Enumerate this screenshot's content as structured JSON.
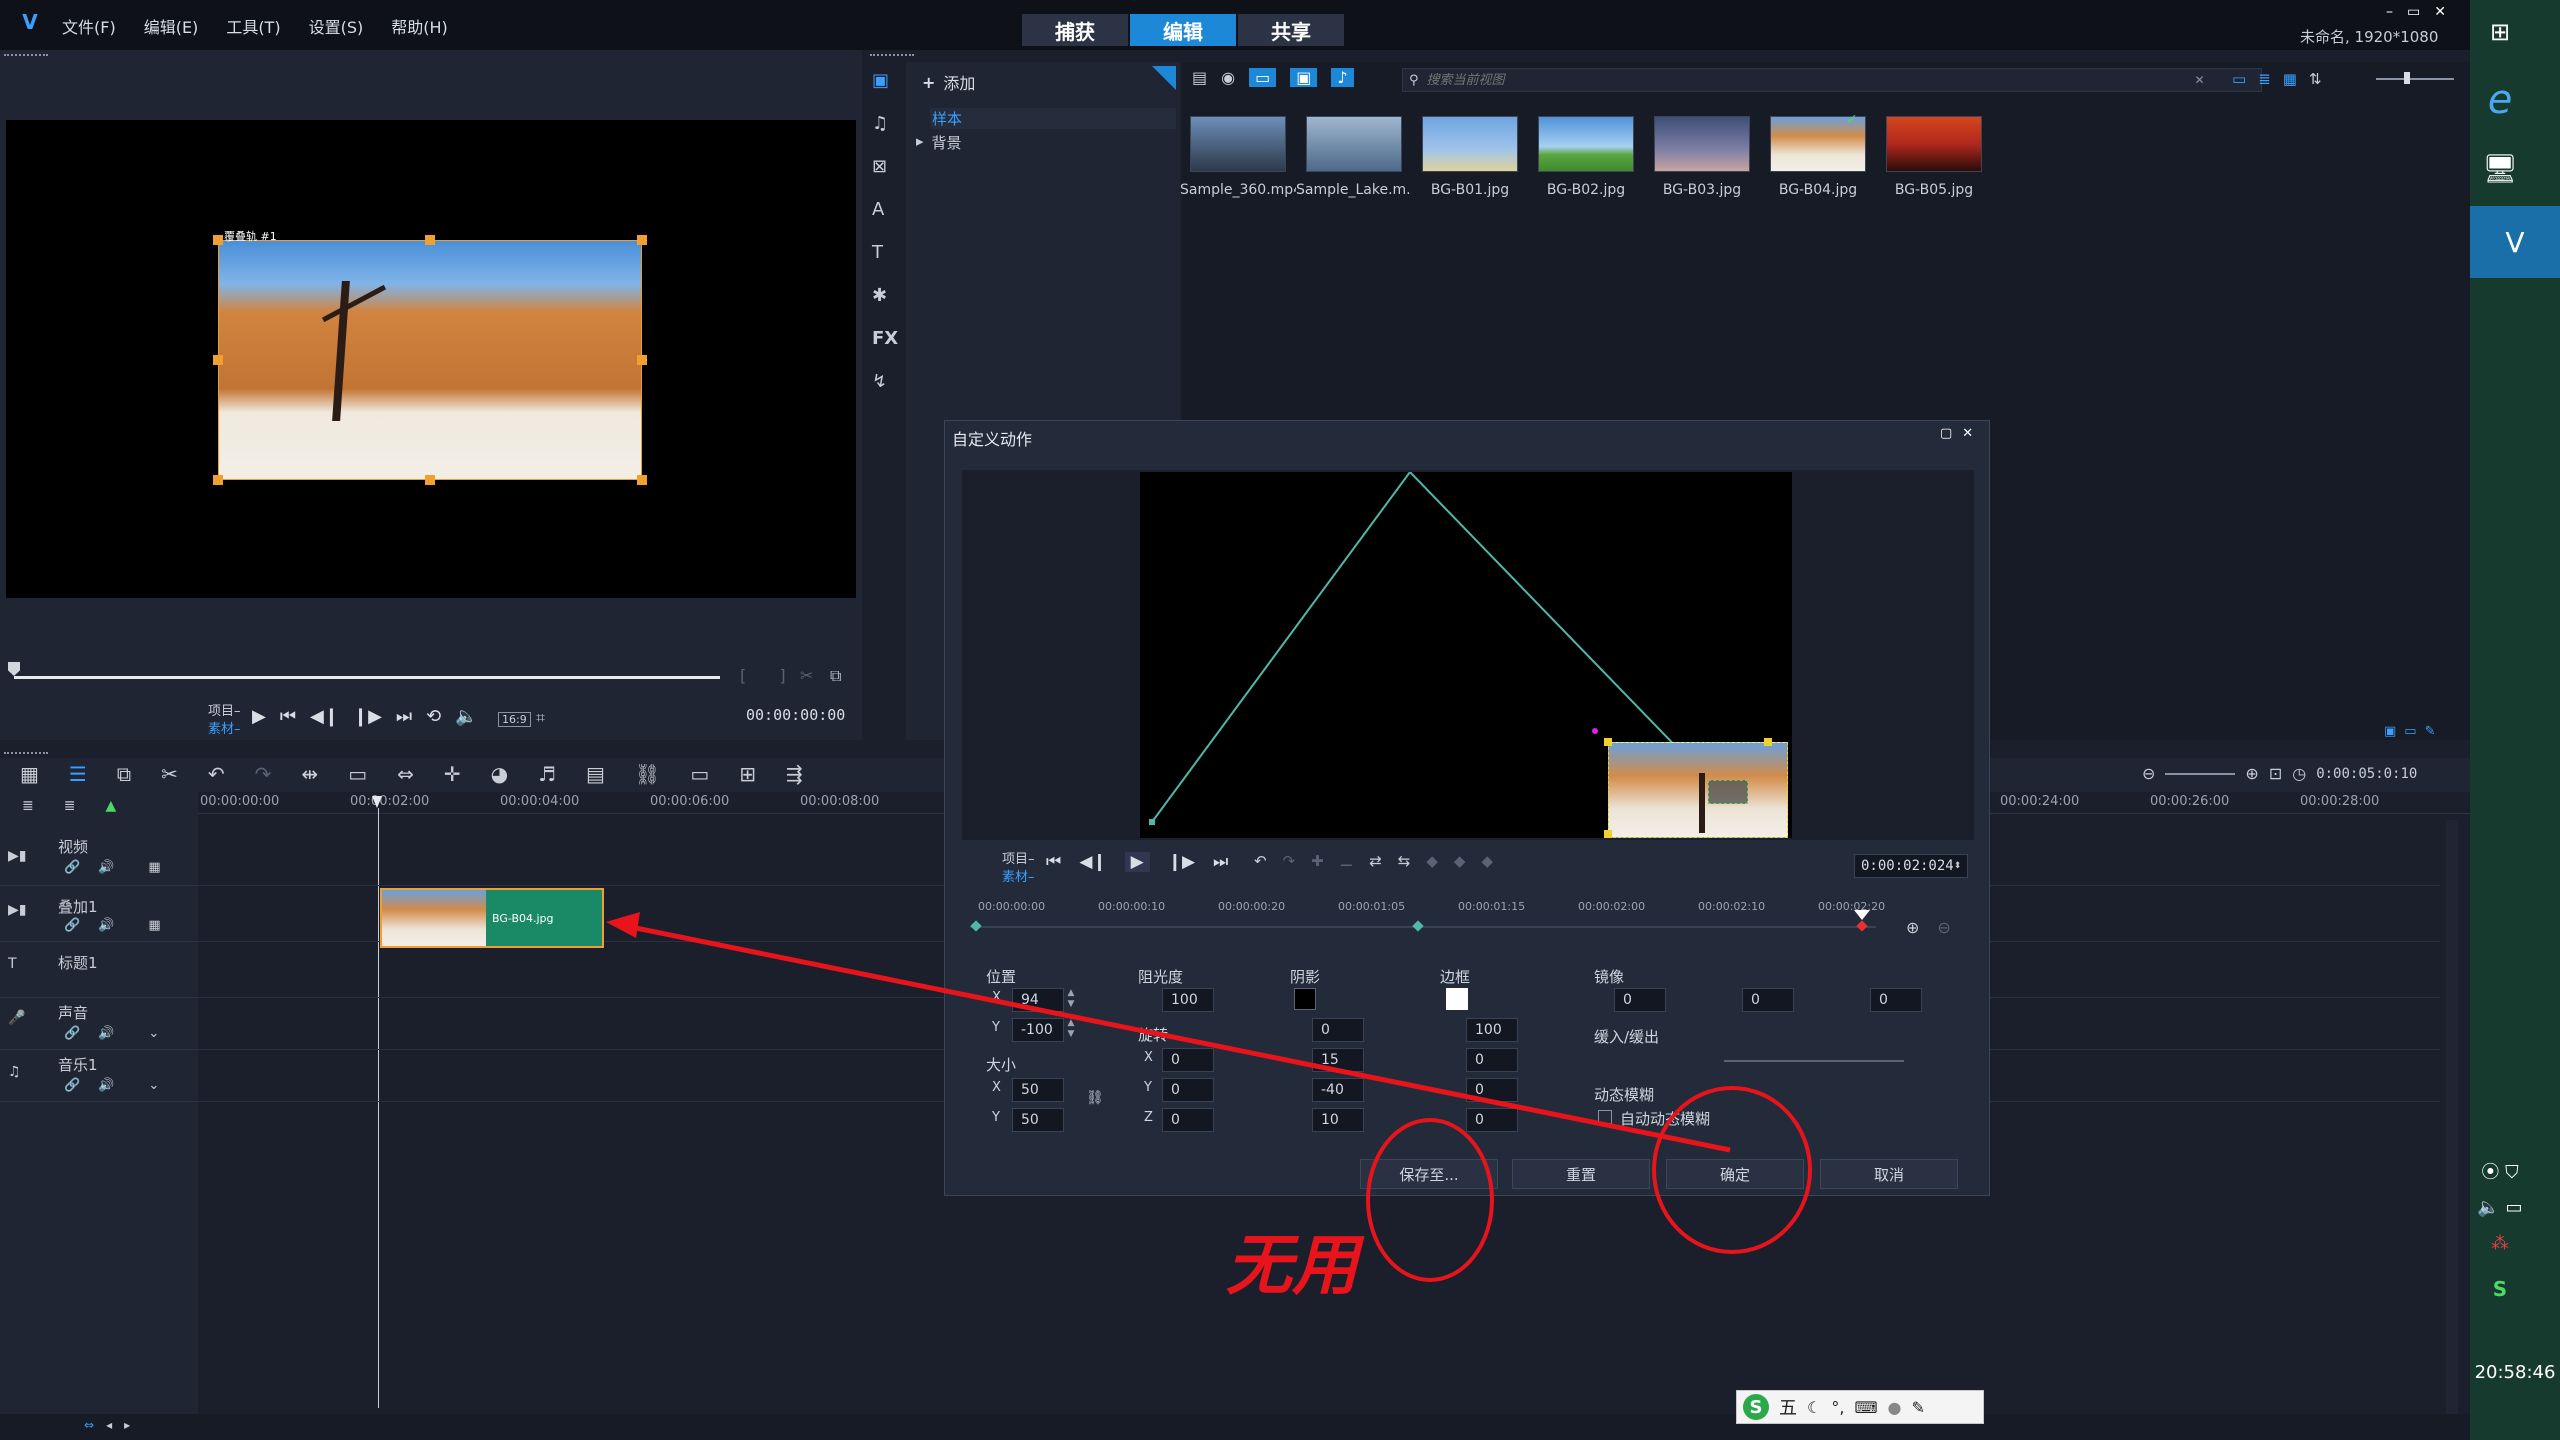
{
  "app": {
    "menu": [
      "文件(F)",
      "编辑(E)",
      "工具(T)",
      "设置(S)",
      "帮助(H)"
    ],
    "tabs": [
      "捕获",
      "编辑",
      "共享"
    ],
    "active_tab": "编辑",
    "window_title": "未命名, 1920*1080",
    "window_controls": [
      "–",
      "▭",
      "✕"
    ]
  },
  "library": {
    "add_label": "添加",
    "tree": [
      "样本",
      "背景"
    ],
    "search_placeholder": "搜索当前视图",
    "thumbnails": [
      {
        "label": "Sample_360.mp4",
        "colors": [
          "#6d8fb8",
          "#2e3a4a"
        ]
      },
      {
        "label": "Sample_Lake.m...",
        "colors": [
          "#9fb6cf",
          "#4d6a89"
        ]
      },
      {
        "label": "BG-B01.jpg",
        "colors": [
          "#6fa4e0",
          "#e0d39a"
        ]
      },
      {
        "label": "BG-B02.jpg",
        "colors": [
          "#4f93d8",
          "#5aa640"
        ]
      },
      {
        "label": "BG-B03.jpg",
        "colors": [
          "#3e4f78",
          "#c9a4a0"
        ]
      },
      {
        "label": "BG-B04.jpg",
        "colors": [
          "#d28c4a",
          "#ece4d6"
        ]
      },
      {
        "label": "BG-B05.jpg",
        "colors": [
          "#b0281e",
          "#2a0d0a"
        ]
      }
    ]
  },
  "preview": {
    "overlay_label": "覆叠轨 #1",
    "project_label": "项目–",
    "clip_label": "素材–",
    "aspect": "16:9",
    "timecode": "00:00:00:00"
  },
  "timeline": {
    "ruler": [
      "00:00:00:00",
      "00:00:02:00",
      "00:00:04:00",
      "00:00:06:00",
      "00:00:08:00"
    ],
    "ruler_right": [
      "00:00:24:00",
      "00:00:26:00",
      "00:00:28:00"
    ],
    "total_time": "0:00:05:0:10",
    "tracks": [
      "视频",
      "叠加1",
      "标题1",
      "声音",
      "音乐1"
    ],
    "clip_name": "BG-B04.jpg"
  },
  "dialog": {
    "title": "自定义动作",
    "project_label": "项目–",
    "clip_label": "素材–",
    "timecode": "0:00:02:024",
    "ruler": [
      "00:00:00:00",
      "00:00:00:10",
      "00:00:00:20",
      "00:00:01:05",
      "00:00:01:15",
      "00:00:02:00",
      "00:00:02:10",
      "00:00:02:20"
    ],
    "position": {
      "label": "位置",
      "x": "94",
      "y": "-100"
    },
    "size": {
      "label": "大小",
      "x": "50",
      "y": "50"
    },
    "opacity": {
      "label": "阻光度",
      "value": "100"
    },
    "rotation": {
      "label": "旋转",
      "x": "0",
      "y": "0",
      "z": "0"
    },
    "shadow": {
      "label": "阴影",
      "v1": "0",
      "v2": "15",
      "v3": "-40",
      "v4": "10"
    },
    "border": {
      "label": "边框",
      "v1": "100",
      "v2": "0",
      "v3": "0",
      "v4": "0"
    },
    "mirror": {
      "label": "镜像",
      "v1": "0",
      "v2": "0",
      "v3": "0"
    },
    "ease": {
      "label": "缓入/缓出"
    },
    "motion_blur": {
      "label": "动态模糊",
      "auto_label": "自动动态模糊"
    },
    "buttons": {
      "save": "保存至...",
      "reset": "重置",
      "ok": "确定",
      "cancel": "取消"
    }
  },
  "annotation": {
    "text": "无用",
    "color": "#e8141c"
  },
  "taskbar": {
    "time": "20:58:46"
  },
  "ime": {
    "logo": "S",
    "mode": "五"
  }
}
